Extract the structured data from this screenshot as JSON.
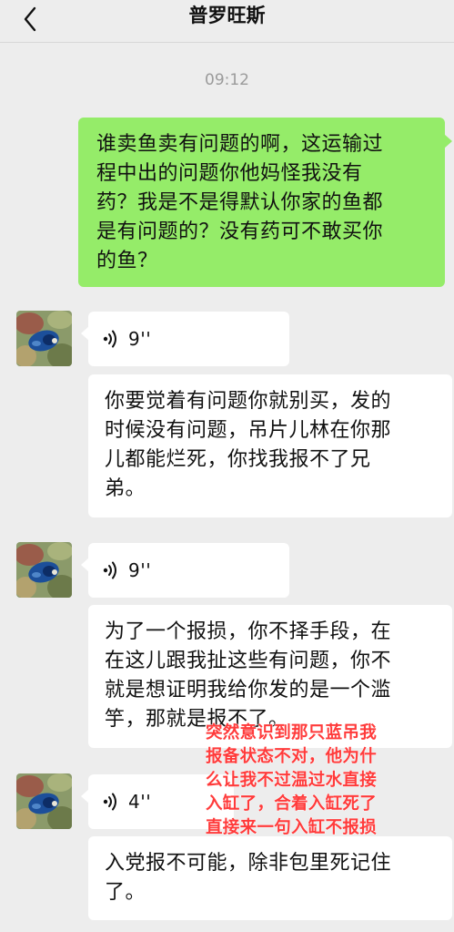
{
  "header": {
    "back_icon": "chevron-left-icon",
    "title": "普罗旺斯"
  },
  "timestamp": "09:12",
  "messages": [
    {
      "type": "text",
      "direction": "sent",
      "text": "谁卖鱼卖有问题的啊，这运输过\n程中出的问题你他妈怪我没有\n药？我是不是得默认你家的鱼都\n是有问题的？没有药可不敢买你\n的鱼？"
    },
    {
      "type": "voice",
      "direction": "received",
      "duration": "9''"
    },
    {
      "type": "text",
      "direction": "received",
      "text": "你要觉着有问题你就别买，发的\n时候没有问题，吊片儿林在你那\n儿都能烂死，你找我报不了兄\n弟。"
    },
    {
      "type": "voice",
      "direction": "received",
      "duration": "9''"
    },
    {
      "type": "text",
      "direction": "received",
      "text": "为了一个报损，你不择手段，在\n在这儿跟我扯这些有问题，你不\n就是想证明我给你发的是一个滥\n竽，那就是报不了。"
    },
    {
      "type": "voice",
      "direction": "received",
      "duration": "4''"
    },
    {
      "type": "text",
      "direction": "received",
      "text": "入党报不可能，除非包里死记住\n了。"
    }
  ],
  "annotation": {
    "text": "突然意识到那只蓝吊我\n报备状态不对，他为什\n么让我不过温过水直接\n入缸了，合着入缸死了\n直接来一句入缸不报损",
    "color": "#ff3b3b"
  },
  "colors": {
    "background": "#ededed",
    "sent_bubble": "#95ec69",
    "received_bubble": "#ffffff"
  }
}
